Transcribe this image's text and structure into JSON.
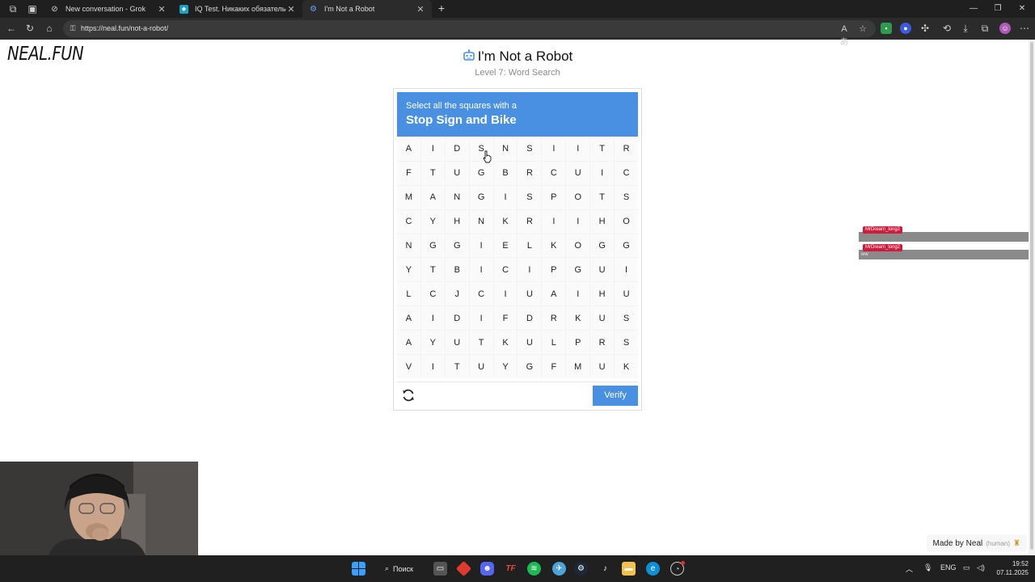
{
  "browser": {
    "tabs": [
      {
        "label": "New conversation - Grok",
        "icon": "grok-icon",
        "active": false
      },
      {
        "label": "IQ Test. Никаких обязательств, б",
        "icon": "iq-test-icon",
        "active": false
      },
      {
        "label": "I'm Not a Robot",
        "icon": "robot-icon",
        "active": true
      }
    ],
    "url": "https://neal.fun/not-a-robot/"
  },
  "page": {
    "logo": "NEAL.FUN",
    "title": "I'm Not a Robot",
    "subtitle": "Level 7: Word Search"
  },
  "captcha": {
    "prompt": "Select all the squares with a",
    "target": "Stop Sign and Bike",
    "grid": [
      [
        "A",
        "I",
        "D",
        "S",
        "N",
        "S",
        "I",
        "I",
        "T",
        "R"
      ],
      [
        "F",
        "T",
        "U",
        "G",
        "B",
        "R",
        "C",
        "U",
        "I",
        "C"
      ],
      [
        "M",
        "A",
        "N",
        "G",
        "I",
        "S",
        "P",
        "O",
        "T",
        "S"
      ],
      [
        "C",
        "Y",
        "H",
        "N",
        "K",
        "R",
        "I",
        "I",
        "H",
        "O"
      ],
      [
        "N",
        "G",
        "G",
        "I",
        "E",
        "L",
        "K",
        "O",
        "G",
        "G"
      ],
      [
        "Y",
        "T",
        "B",
        "I",
        "C",
        "I",
        "P",
        "G",
        "U",
        "I"
      ],
      [
        "L",
        "C",
        "J",
        "C",
        "I",
        "U",
        "A",
        "I",
        "H",
        "U"
      ],
      [
        "A",
        "I",
        "D",
        "I",
        "F",
        "D",
        "R",
        "K",
        "U",
        "S"
      ],
      [
        "A",
        "Y",
        "U",
        "T",
        "K",
        "U",
        "L",
        "P",
        "R",
        "S"
      ],
      [
        "V",
        "I",
        "T",
        "U",
        "Y",
        "G",
        "F",
        "M",
        "U",
        "K"
      ]
    ],
    "verify_label": "Verify",
    "accent": "#4a90e2"
  },
  "overlay": {
    "tag1": "MrDream_long2",
    "tag2": "MrDream_long2",
    "small": "ww"
  },
  "footer": {
    "made_by": "Made by Neal",
    "human": "(human)"
  },
  "taskbar": {
    "search_label": "Поиск",
    "lang": "ENG",
    "time": "19:52",
    "date": "07.11.2025"
  }
}
